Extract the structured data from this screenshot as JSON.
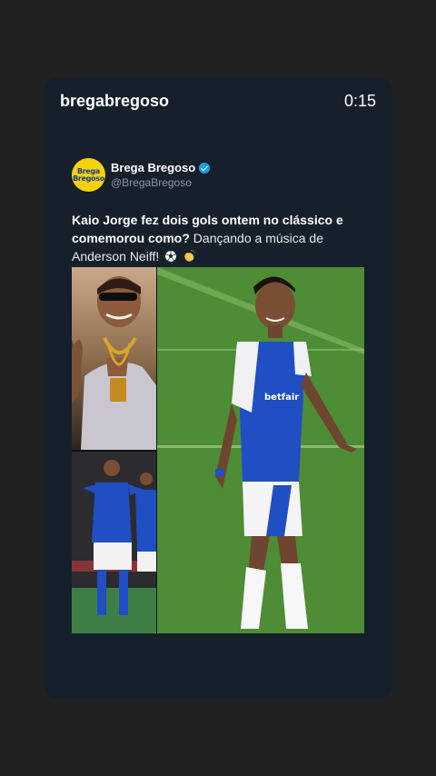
{
  "story": {
    "username": "bregabregoso",
    "timer": "0:15"
  },
  "tweet": {
    "avatar_text_top": "Brega",
    "avatar_text_bottom": "Bregoso",
    "display_name": "Brega Bregoso",
    "handle": "@BregaBregoso",
    "verified": true,
    "text_bold": "Kaio Jorge fez dois gols ontem no clássico e comemorou como?",
    "text_regular": " Dançando a música de Anderson Neiff!",
    "emojis": [
      "soccer-ball-icon",
      "clapping-hands-icon"
    ]
  },
  "colors": {
    "background": "#212121",
    "card": "#15202b",
    "verified": "#1d9bf0",
    "kit_blue": "#1f4fc2",
    "pitch_green": "#4e8c35"
  }
}
